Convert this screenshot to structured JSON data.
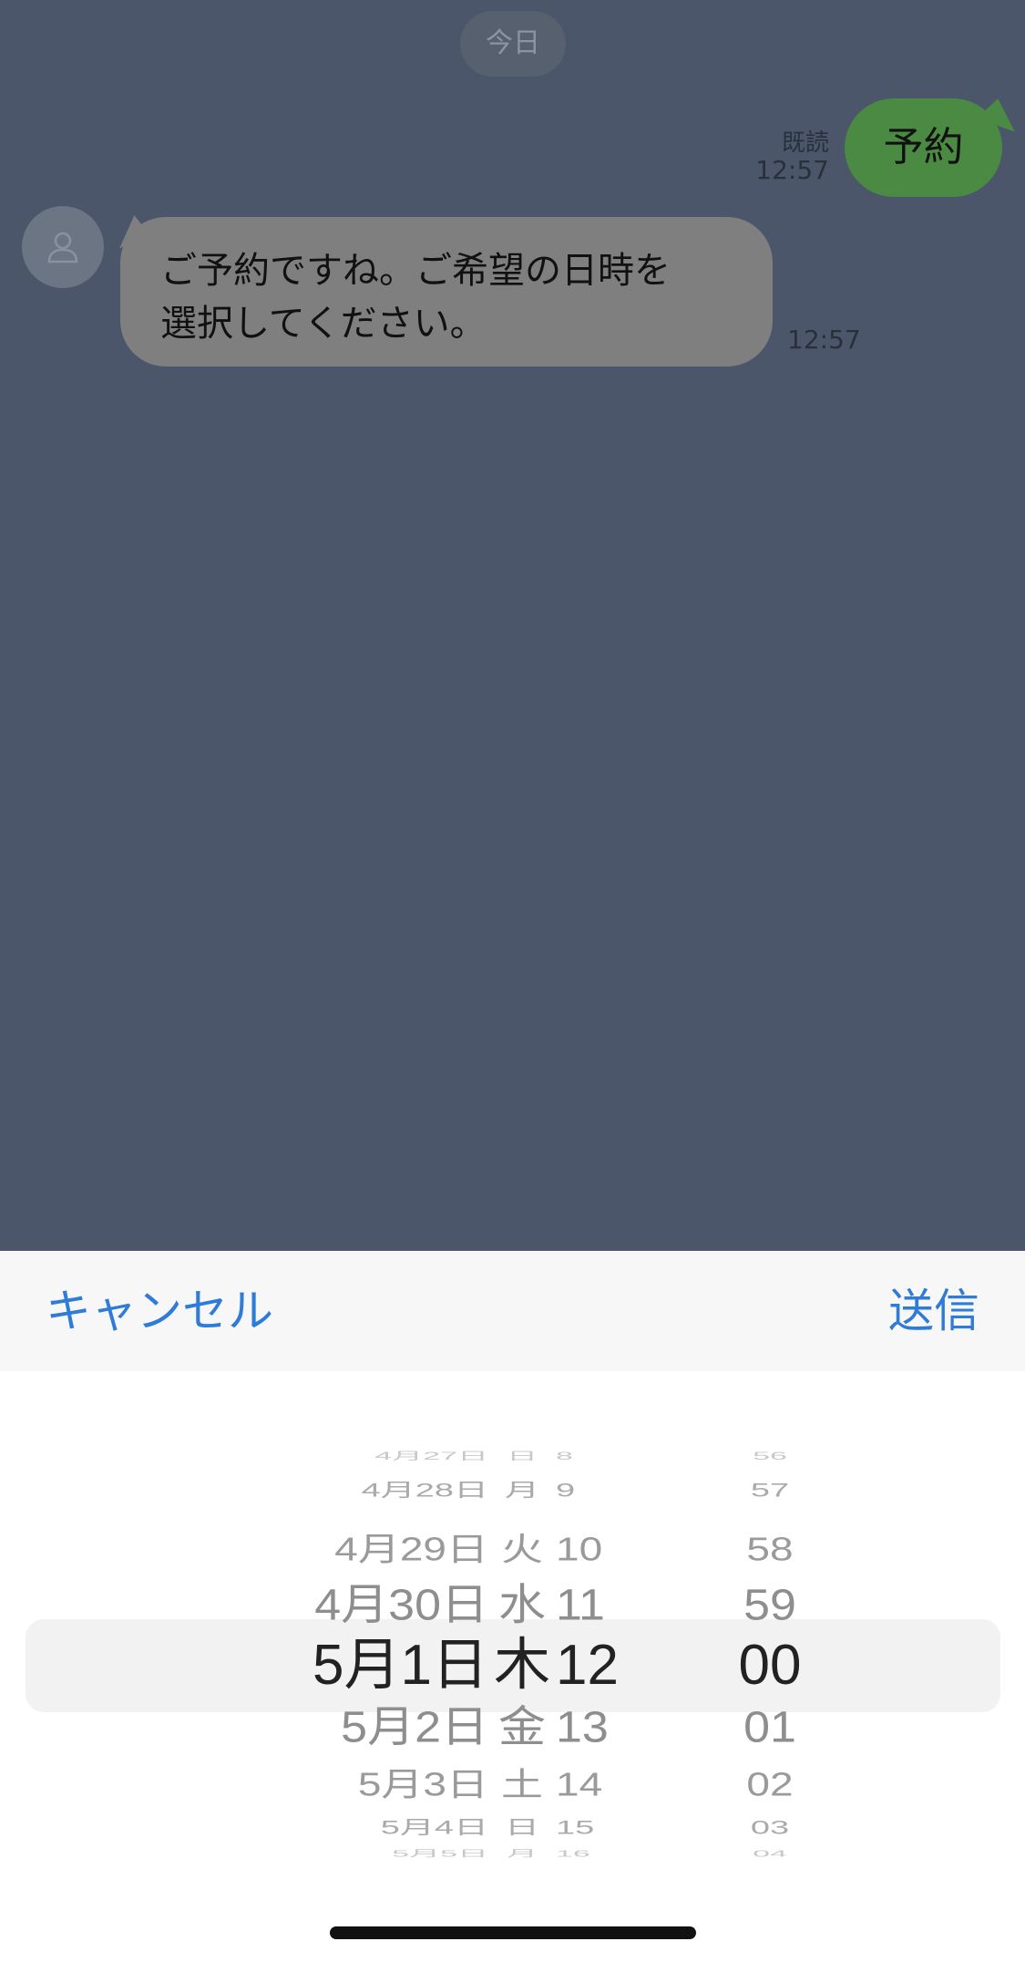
{
  "chat": {
    "date_label": "今日",
    "outgoing": {
      "text": "予約",
      "read_label": "既読",
      "time": "12:57"
    },
    "incoming": {
      "text": "ご予約ですね。ご希望の日時を選択してください。",
      "time": "12:57"
    }
  },
  "picker": {
    "cancel_label": "キャンセル",
    "send_label": "送信",
    "dates": [
      "4月27日",
      "4月28日",
      "4月29日",
      "4月30日",
      "5月1日",
      "5月2日",
      "5月3日",
      "5月4日",
      "5月5日"
    ],
    "weekdays": [
      "日",
      "月",
      "火",
      "水",
      "木",
      "金",
      "土",
      "日",
      "月"
    ],
    "hours": [
      "8",
      "9",
      "10",
      "11",
      "12",
      "13",
      "14",
      "15",
      "16"
    ],
    "minutes": [
      "56",
      "57",
      "58",
      "59",
      "00",
      "01",
      "02",
      "03",
      "04"
    ],
    "selected_index": 4
  },
  "colors": {
    "chat_background": "#4b566b",
    "outgoing_bubble": "#4b8a43",
    "incoming_bubble": "#7f7f7f",
    "toolbar_link": "#2f7bd8"
  }
}
